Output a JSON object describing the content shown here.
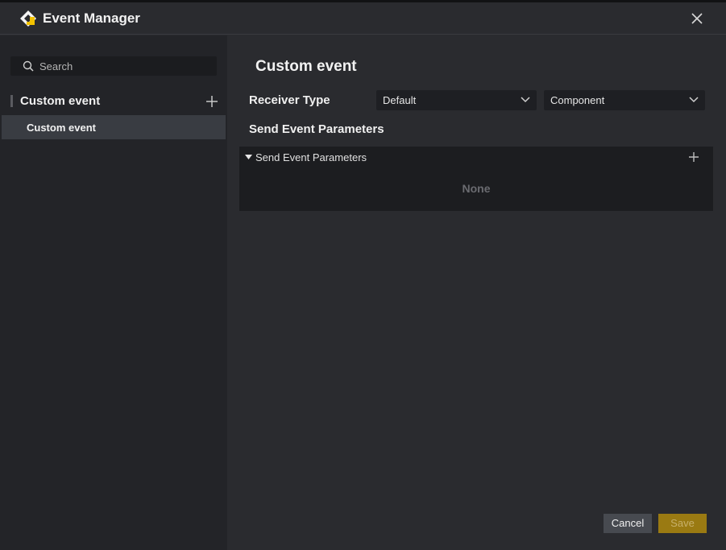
{
  "window": {
    "title": "Event Manager"
  },
  "sidebar": {
    "search_placeholder": "Search",
    "group": {
      "label": "Custom event"
    },
    "items": [
      {
        "label": "Custom event",
        "selected": true
      }
    ]
  },
  "main": {
    "title": "Custom event",
    "receiver_type": {
      "label": "Receiver Type",
      "select1_value": "Default",
      "select2_value": "Component"
    },
    "send_params": {
      "label": "Send Event Parameters",
      "panel_label": "Send Event Parameters",
      "empty_text": "None"
    }
  },
  "footer": {
    "cancel_label": "Cancel",
    "save_label": "Save"
  },
  "colors": {
    "accent": "#f2c200",
    "save_bg": "#9a7a12",
    "selected_item": "#393c42"
  },
  "icons": {
    "logo": "app-logo-icon",
    "close": "close-icon",
    "search": "search-icon",
    "add": "plus-icon",
    "dropdown": "chevron-down-icon",
    "expand": "triangle-down-icon"
  }
}
